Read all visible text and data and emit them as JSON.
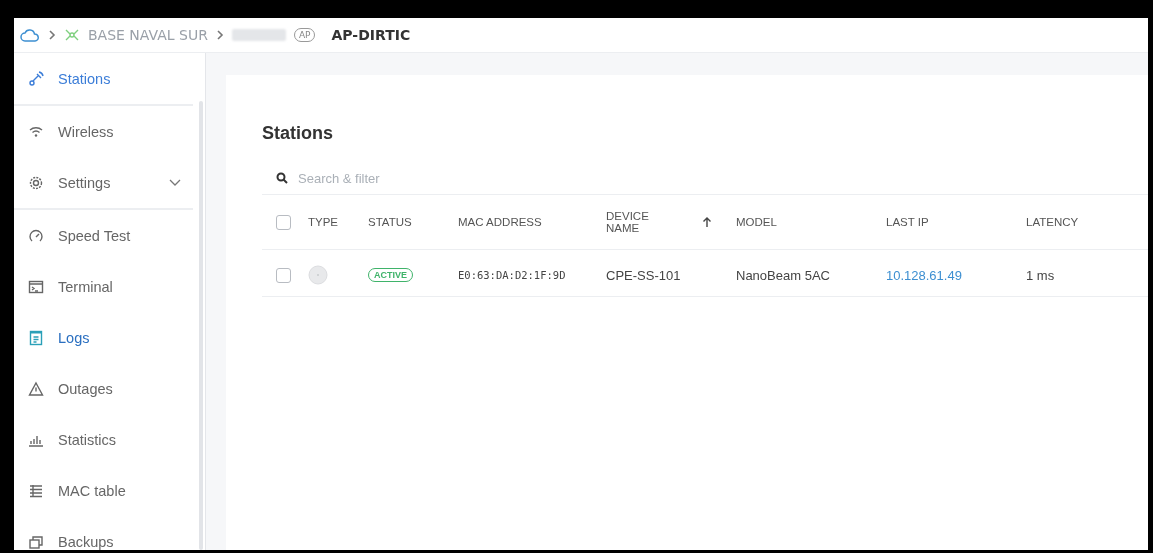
{
  "breadcrumb": {
    "site": "BASE NAVAL SUR",
    "device_badge": "AP",
    "device": "AP-DIRTIC"
  },
  "sidebar": {
    "items": [
      {
        "label": "Stations",
        "kind": "stations",
        "selected": true,
        "highlighted": false
      },
      {
        "label": "Wireless",
        "kind": "wifi",
        "selected": false,
        "highlighted": false
      },
      {
        "label": "Settings",
        "kind": "gear",
        "selected": false,
        "highlighted": false,
        "expanded": false
      },
      {
        "label": "Speed Test",
        "kind": "gauge",
        "selected": false,
        "highlighted": false
      },
      {
        "label": "Terminal",
        "kind": "terminal",
        "selected": false,
        "highlighted": false
      },
      {
        "label": "Logs",
        "kind": "logs",
        "selected": false,
        "highlighted": true
      },
      {
        "label": "Outages",
        "kind": "warning",
        "selected": false,
        "highlighted": false
      },
      {
        "label": "Statistics",
        "kind": "stats",
        "selected": false,
        "highlighted": false
      },
      {
        "label": "MAC table",
        "kind": "table",
        "selected": false,
        "highlighted": false
      },
      {
        "label": "Backups",
        "kind": "backup",
        "selected": false,
        "highlighted": false
      }
    ]
  },
  "page": {
    "title": "Stations",
    "search": {
      "placeholder": "Search & filter"
    }
  },
  "table": {
    "select_all": {
      "checked": false
    },
    "columns": [
      {
        "label": "TYPE",
        "sorted": false
      },
      {
        "label": "STATUS",
        "sorted": false
      },
      {
        "label": "MAC ADDRESS",
        "sorted": false
      },
      {
        "label": "DEVICE NAME",
        "sorted": true
      },
      {
        "label": "MODEL",
        "sorted": false
      },
      {
        "label": "LAST IP",
        "sorted": false
      },
      {
        "label": "LATENCY",
        "sorted": false
      }
    ],
    "rows": [
      {
        "checked": false,
        "status": "ACTIVE",
        "mac": "E0:63:DA:D2:1F:9D",
        "device_name": "CPE-SS-101",
        "model": "NanoBeam 5AC",
        "last_ip": "10.128.61.49",
        "latency": "1 ms"
      }
    ]
  }
}
